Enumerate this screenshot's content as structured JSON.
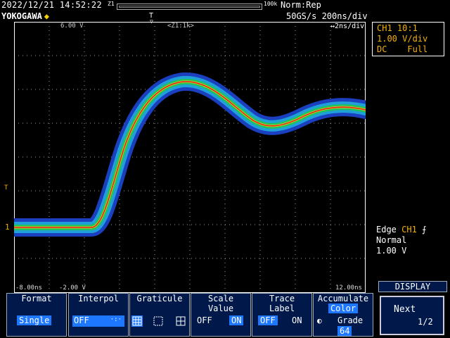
{
  "header": {
    "datetime": "2022/12/21 14:52:22",
    "brand": "YOKOGAWA",
    "zoom_marker": "Z1",
    "history_label": "100k",
    "acq_mode": "Norm:Rep",
    "sampling": "50GS/s 200ns/div",
    "trigger_pos_marker": "T"
  },
  "ch1_box": {
    "line1": "CH1 10:1",
    "line2": "1.00 V/div",
    "line3": "DC    Full"
  },
  "graticule_labels": {
    "v_top": "6.00 V",
    "zoom_label": "<Z1:1k>",
    "subdiv": "↔2ns/div",
    "t_left": "-8.00ns",
    "v_bottom": "-2.00 V",
    "t_right": "12.00ns",
    "trigger_level_mark": "T",
    "ground_mark": "1"
  },
  "trigger": {
    "line1_label": "Edge",
    "line1_ch": "CH1",
    "mode": "Normal",
    "level": "1.00 V"
  },
  "softkeys": [
    {
      "title": "Format",
      "value": "Single"
    },
    {
      "title": "Interpol",
      "value": "OFF"
    },
    {
      "title": "Graticule"
    },
    {
      "title": "Scale",
      "title2": "Value",
      "off": "OFF",
      "on": "ON"
    },
    {
      "title": "Trace",
      "title2": "Label",
      "off": "OFF",
      "on": "ON"
    },
    {
      "title": "Accumulate",
      "title2": "Color",
      "mode": "Grade",
      "count": "64"
    }
  ],
  "display_menu": {
    "title": "DISPLAY",
    "next_label": "Next",
    "page": "1/2"
  },
  "colors": {
    "accent_orange": "#f5b000",
    "softkey_bg": "#00184a",
    "selected": "#1e78ff"
  },
  "waveform": {
    "type": "color-graded accumulated step response",
    "channel": "CH1"
  }
}
